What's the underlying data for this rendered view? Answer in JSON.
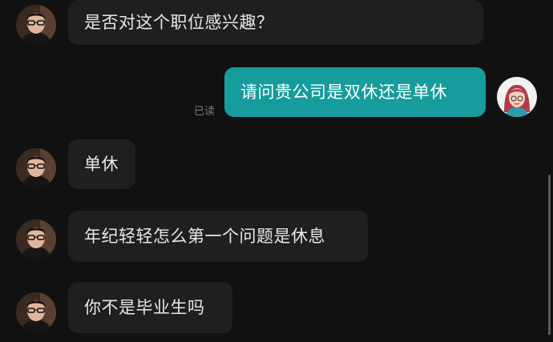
{
  "messages": [
    {
      "side": "in",
      "text": "是否对这个职位感兴趣？",
      "avatar_icon": "recruiter-avatar-icon"
    },
    {
      "side": "out",
      "text": "请问贵公司是双休还是单休",
      "status": "已读",
      "avatar_icon": "user-avatar-icon"
    },
    {
      "side": "in",
      "text": "单休",
      "avatar_icon": "recruiter-avatar-icon"
    },
    {
      "side": "in",
      "text": "年纪轻轻怎么第一个问题是休息",
      "avatar_icon": "recruiter-avatar-icon"
    },
    {
      "side": "in",
      "text": "你不是毕业生吗",
      "avatar_icon": "recruiter-avatar-icon"
    }
  ],
  "colors": {
    "background": "#111111",
    "incoming_bubble": "#1f1f1f",
    "outgoing_bubble": "#169c9c",
    "read_status": "#7a7a7a"
  }
}
